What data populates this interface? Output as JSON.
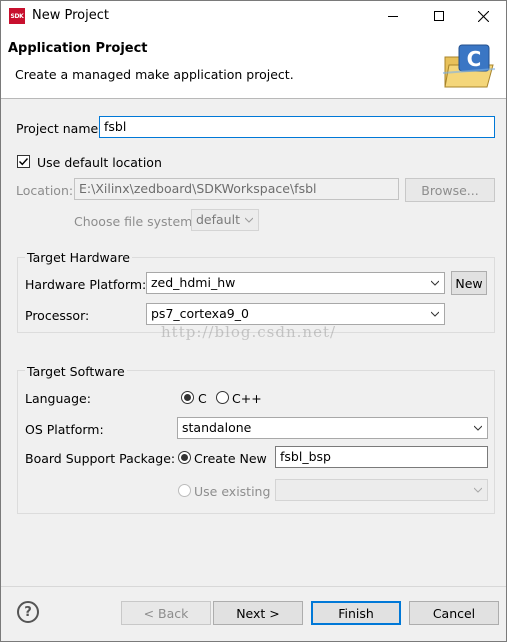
{
  "window": {
    "title": "New Project",
    "app_icon_text": "SDK"
  },
  "banner": {
    "title": "Application Project",
    "description": "Create a managed make application project."
  },
  "project": {
    "name_label": "Project name:",
    "name_value": "fsbl",
    "use_default_location_label": "Use default location",
    "use_default_location_checked": true,
    "location_label": "Location:",
    "location_value": "E:\\Xilinx\\zedboard\\SDKWorkspace\\fsbl",
    "browse_label": "Browse...",
    "file_system_label": "Choose file system:",
    "file_system_value": "default"
  },
  "target_hardware": {
    "title": "Target Hardware",
    "platform_label": "Hardware Platform:",
    "platform_value": "zed_hdmi_hw",
    "new_button_label": "New",
    "processor_label": "Processor:",
    "processor_value": "ps7_cortexa9_0"
  },
  "watermark": "http://blog.csdn.net/",
  "target_software": {
    "title": "Target Software",
    "language_label": "Language:",
    "language_options": [
      "C",
      "C++"
    ],
    "language_selected": "C",
    "os_label": "OS Platform:",
    "os_value": "standalone",
    "bsp_label": "Board Support Package:",
    "bsp_create_new_label": "Create New",
    "bsp_name_value": "fsbl_bsp",
    "bsp_use_existing_label": "Use existing"
  },
  "footer": {
    "help_icon": "?",
    "back_label": "< Back",
    "next_label": "Next >",
    "finish_label": "Finish",
    "cancel_label": "Cancel"
  },
  "colors": {
    "focus": "#0078d7",
    "app_icon": "#c8102e"
  }
}
